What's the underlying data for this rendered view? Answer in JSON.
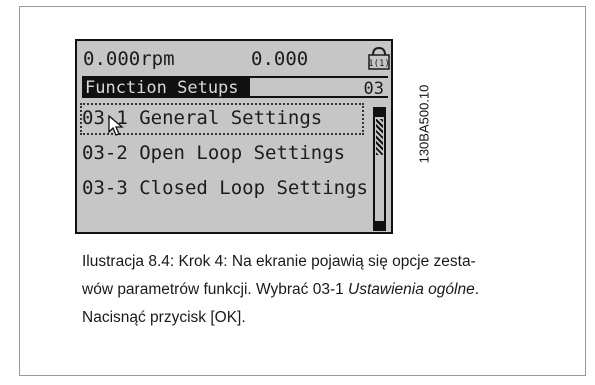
{
  "lcd": {
    "speed": "0.000rpm",
    "value": "0.000",
    "lock_label": "1(1)",
    "menu_title": "Function Setups",
    "menu_code": "03",
    "items": [
      "03-1 General Settings",
      "03-2 Open Loop Settings",
      "03-3 Closed Loop Settings"
    ]
  },
  "code_label": "130BA500.10",
  "caption": {
    "line1": "Ilustracja 8.4: Krok 4: Na ekranie pojawią się opcje zesta-",
    "line2_prefix": "wów parametrów funkcji. Wybrać 03-1 ",
    "line2_italic": "Ustawienia ogólne",
    "line2_suffix": ".",
    "line3": "Nacisnąć przycisk [OK]."
  }
}
